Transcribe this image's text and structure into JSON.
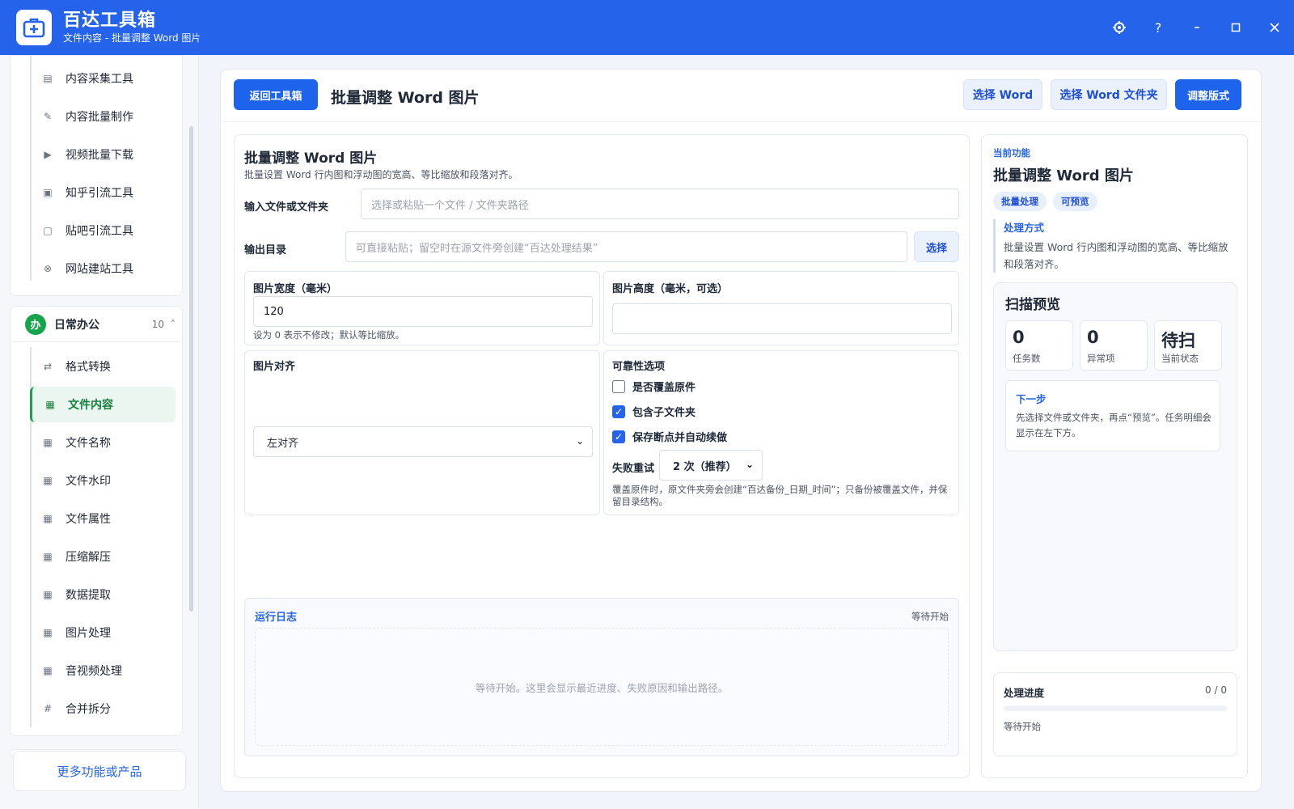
{
  "app": {
    "title": "百达工具箱",
    "subtitle": "文件内容 - 批量调整 Word 图片"
  },
  "sidebar": {
    "top_items": [
      {
        "label": "内容采集工具",
        "icon": "collect-icon"
      },
      {
        "label": "内容批量制作",
        "icon": "pen-icon"
      },
      {
        "label": "视频批量下载",
        "icon": "video-icon"
      },
      {
        "label": "知乎引流工具",
        "icon": "zhihu-icon"
      },
      {
        "label": "贴吧引流工具",
        "icon": "tieba-icon"
      },
      {
        "label": "网站建站工具",
        "icon": "web-icon"
      }
    ],
    "group": {
      "badge": "办",
      "name": "日常办公",
      "count": "10",
      "caret": "˄"
    },
    "group_items": [
      {
        "label": "格式转换",
        "icon": "swap-icon"
      },
      {
        "label": "文件内容",
        "icon": "grid-icon",
        "active": true
      },
      {
        "label": "文件名称",
        "icon": "grid-icon"
      },
      {
        "label": "文件水印",
        "icon": "grid-icon"
      },
      {
        "label": "文件属性",
        "icon": "grid-icon"
      },
      {
        "label": "压缩解压",
        "icon": "grid-icon"
      },
      {
        "label": "数据提取",
        "icon": "grid-icon"
      },
      {
        "label": "图片处理",
        "icon": "grid-icon"
      },
      {
        "label": "音视频处理",
        "icon": "grid-icon"
      },
      {
        "label": "合并拆分",
        "icon": "hash-icon"
      }
    ],
    "more_label": "更多功能或产品"
  },
  "toolbar": {
    "back_label": "返回工具箱",
    "page_title": "批量调整 Word 图片",
    "select_word_label": "选择 Word",
    "select_folder_label": "选择 Word 文件夹",
    "adjust_label": "调整版式"
  },
  "form": {
    "title": "批量调整 Word 图片",
    "description": "批量设置 Word 行内图和浮动图的宽高、等比缩放和段落对齐。",
    "input_label": "输入文件或文件夹",
    "input_placeholder": "选择或粘贴一个文件 / 文件夹路径",
    "output_label": "输出目录",
    "output_placeholder": "可直接粘贴；留空时在源文件旁创建“百达处理结果”",
    "output_select_label": "选择",
    "width_label": "图片宽度（毫米）",
    "width_value": "120",
    "width_hint": "设为 0 表示不修改；默认等比缩放。",
    "height_label": "图片高度（毫米，可选）",
    "height_value": "",
    "align_label": "图片对齐",
    "align_value": "左对齐",
    "reliability_label": "可靠性选项",
    "options": [
      {
        "label": "是否覆盖原件",
        "checked": false
      },
      {
        "label": "包含子文件夹",
        "checked": true
      },
      {
        "label": "保存断点并自动续做",
        "checked": true
      }
    ],
    "retry_label": "失败重试",
    "retry_value": "2 次（推荐）",
    "backup_hint": "覆盖原件时，原文件夹旁会创建“百达备份_日期_时间”；只备份被覆盖文件，并保留目录结构。"
  },
  "log": {
    "title": "运行日志",
    "status": "等待开始",
    "placeholder": "等待开始。这里会显示最近进度、失败原因和输出路径。"
  },
  "side": {
    "eyebrow": "当前功能",
    "title": "批量调整 Word 图片",
    "tags": [
      "批量处理",
      "可预览"
    ],
    "method_title": "处理方式",
    "method_desc": "批量设置 Word 行内图和浮动图的宽高、等比缩放和段落对齐。",
    "scan_title": "扫描预览",
    "stats": [
      {
        "value": "0",
        "label": "任务数"
      },
      {
        "value": "0",
        "label": "异常项"
      },
      {
        "value": "待扫",
        "label": "当前状态"
      }
    ],
    "next_title": "下一步",
    "next_desc": "先选择文件或文件夹，再点“预览”。任务明细会显示在左下方。",
    "progress_title": "处理进度",
    "progress_count": "0 / 0",
    "progress_fraction": 0,
    "progress_status": "等待开始"
  },
  "colors": {
    "brand": "#2563eb",
    "active_green": "#16a34a"
  }
}
